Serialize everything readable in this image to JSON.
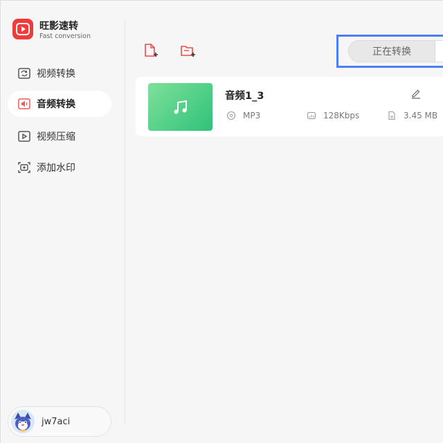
{
  "app": {
    "name": "旺影速转",
    "subtitle": "Fast conversion",
    "accent_color": "#ef3b3b"
  },
  "sidebar": {
    "items": [
      {
        "label": "视频转换",
        "icon": "video-convert-icon",
        "active": false
      },
      {
        "label": "音频转换",
        "icon": "audio-convert-icon",
        "active": true
      },
      {
        "label": "视频压缩",
        "icon": "video-compress-icon",
        "active": false
      },
      {
        "label": "添加水印",
        "icon": "watermark-icon",
        "active": false
      }
    ]
  },
  "user": {
    "name": "jw7aci",
    "avatar_icon": "avatar-icon"
  },
  "toolbar": {
    "add_file_icon": "add-file-icon",
    "add_folder_icon": "add-folder-icon",
    "status_tab_active": "正在转换",
    "highlight_color": "#4d7cf3"
  },
  "files": [
    {
      "name": "音频1_3",
      "format": "MP3",
      "bitrate": "128Kbps",
      "size": "3.45 MB",
      "thumb_icon": "music-note-icon"
    }
  ]
}
